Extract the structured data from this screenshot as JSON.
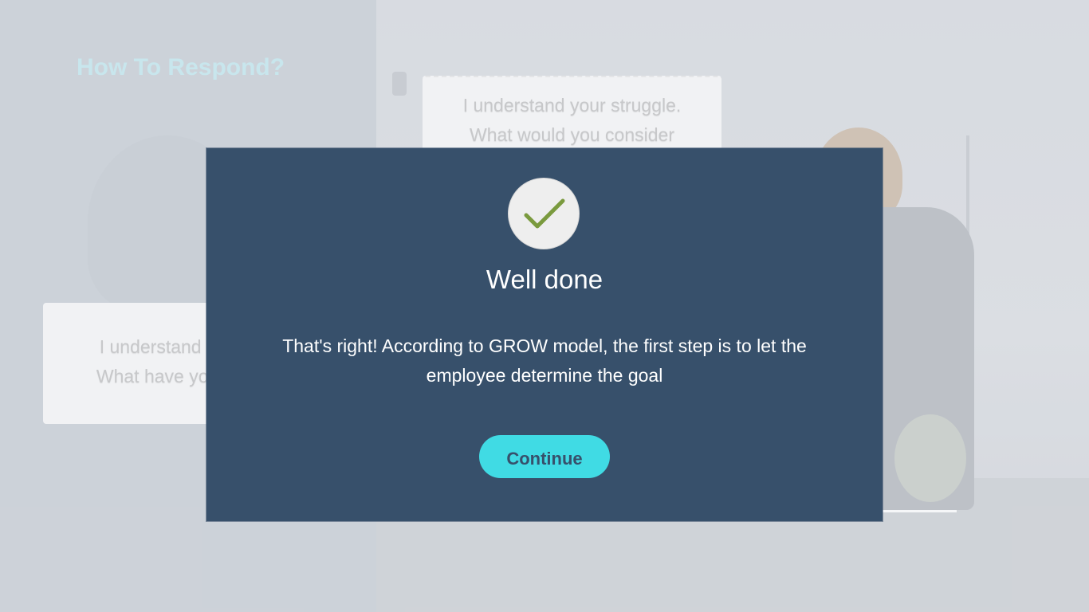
{
  "background": {
    "heading": "How To Respond?",
    "options": [
      {
        "lines": [
          "I understand your struggle.",
          "What would you consider"
        ]
      },
      {
        "lines": [
          "I understand yo",
          "What have you t"
        ]
      }
    ]
  },
  "modal": {
    "icon": "checkmark-icon",
    "title": "Well done",
    "message": "That's right!  According to GROW model, the first step is to let the employee determine the goal",
    "continue_label": "Continue"
  },
  "colors": {
    "modal_bg": "#37506b",
    "button_bg": "#40dbe4",
    "check_color": "#7a9a3e",
    "heading_color": "#c3eaf0"
  }
}
